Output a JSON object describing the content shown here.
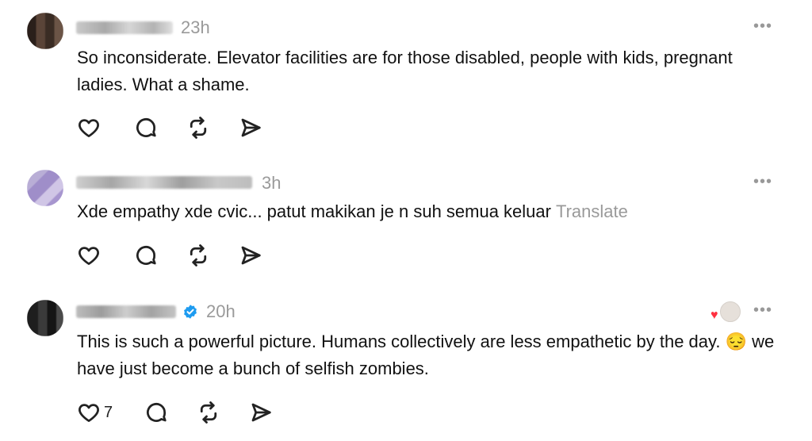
{
  "posts": [
    {
      "time": "23h",
      "text": "So inconsiderate. Elevator facilities are for those disabled, people with kids, pregnant ladies. What a shame.",
      "more_label": "•••",
      "translate": ""
    },
    {
      "time": "3h",
      "text": "Xde empathy xde cvic... patut makikan je n suh semua keluar",
      "more_label": "•••",
      "translate": "Translate"
    },
    {
      "time": "20h",
      "text": "This is such a powerful picture. Humans collectively are less empathetic by the day. 😔 we have just become a bunch of selfish zombies.",
      "more_label": "•••",
      "like_count": "7"
    }
  ],
  "icons": {
    "like": "heart-icon",
    "reply": "comment-icon",
    "repost": "repost-icon",
    "share": "send-icon",
    "verified": "verified-badge-icon"
  },
  "colors": {
    "text": "#111111",
    "muted": "#9a9a9a",
    "verified": "#1d9bf0",
    "heart": "#ff3040"
  }
}
